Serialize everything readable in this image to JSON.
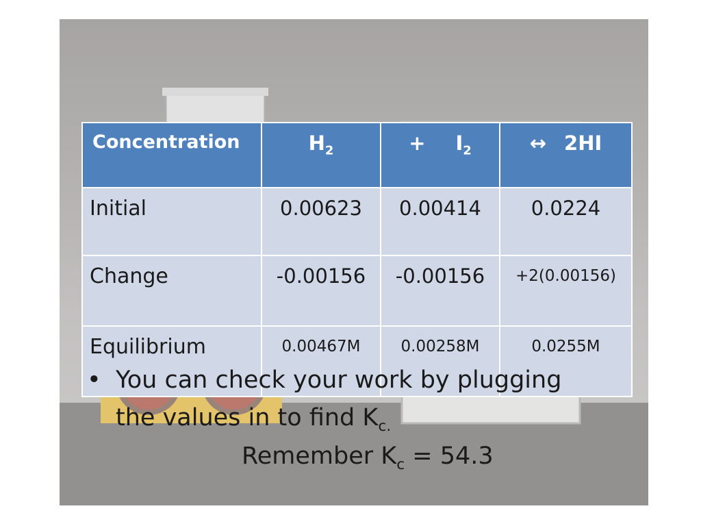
{
  "table": {
    "headers": {
      "concentration": "Concentration",
      "h2": {
        "base": "H",
        "sub": "2"
      },
      "i2": {
        "prefix": "+",
        "base": "I",
        "sub": "2"
      },
      "hi": {
        "arrow": "↔",
        "label": "2HI"
      }
    },
    "rows": [
      {
        "label": "Initial",
        "h2": "0.00623",
        "i2": "0.00414",
        "hi": "0.0224"
      },
      {
        "label": "Change",
        "h2": "-0.00156",
        "i2": "-0.00156",
        "hi": "+2(0.00156)"
      },
      {
        "label": "Equilibrium",
        "h2": "0.00467M",
        "i2": "0.00258M",
        "hi": "0.0255M"
      }
    ]
  },
  "bullet": {
    "marker": "•",
    "text": "You can check your work by plugging the values in to find K",
    "sub": "c."
  },
  "remember": {
    "prefix": "Remember K",
    "sub": "c",
    "suffix": " = 54.3"
  },
  "colors": {
    "header_bg": "#4f81bd",
    "cell_bg": "#d0d8e8",
    "text": "#1a1a1a"
  }
}
